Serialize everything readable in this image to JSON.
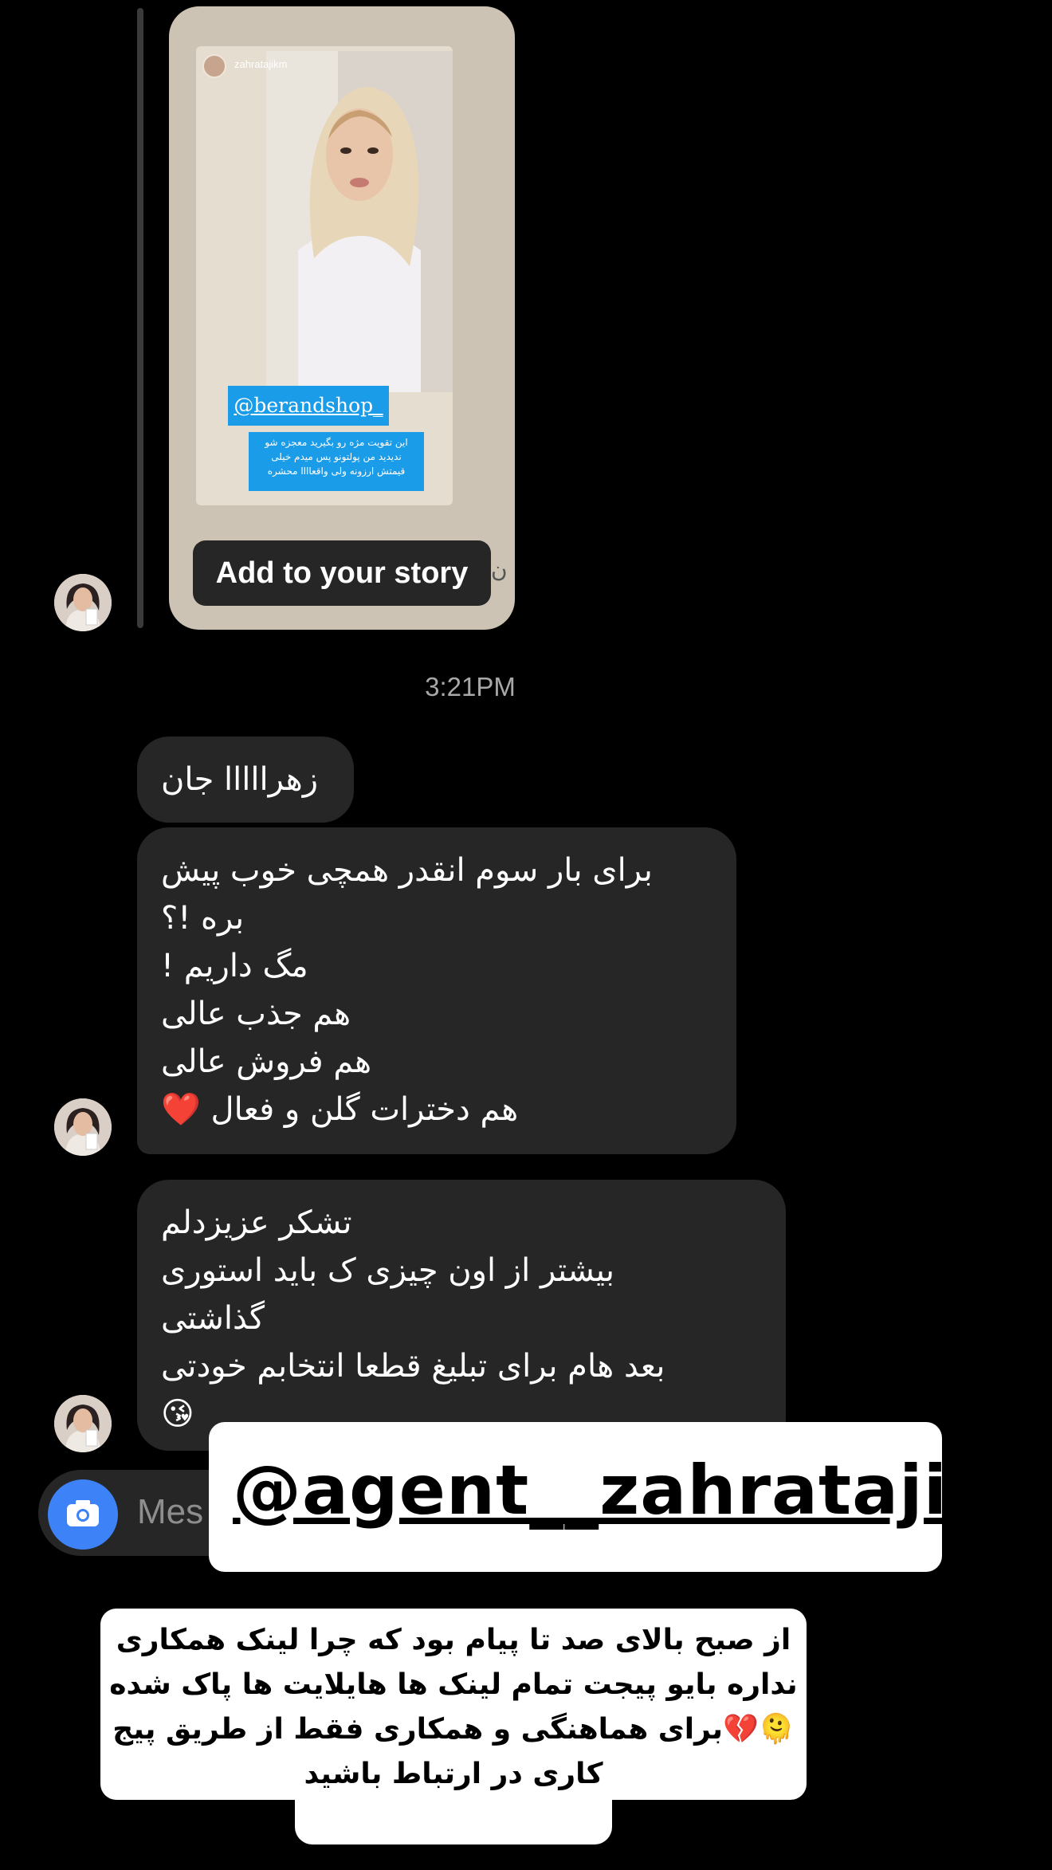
{
  "story": {
    "username": "zahratajikm",
    "mention": "@berandshop_",
    "caption_lines": [
      "این تقویت مژه رو بگیرید معجزه شو",
      "ندیدید من پولتونو پس میدم خیلی",
      "قیمتش ارزونه ولی واقعاااا محشره"
    ],
    "add_button": "Add to your story"
  },
  "timestamp": "3:21PM",
  "messages": [
    {
      "lines": [
        "زهرااااا جان"
      ]
    },
    {
      "lines": [
        "برای بار سوم انقدر همچی خوب پیش",
        "بره !؟",
        "مگ داریم !",
        "هم جذب عالی",
        "هم فروش عالی",
        "هم دخترات گلن و فعال"
      ],
      "emoji": "❤️"
    },
    {
      "lines": [
        "تشکر عزیزدلم",
        "بیشتر از اون چیزی ک باید استوری",
        "گذاشتی",
        "بعد هام برای تبلیغ قطعا انتخابم خودتی"
      ],
      "emoji": "😘"
    }
  ],
  "composer": {
    "placeholder": "Mes"
  },
  "overlay": {
    "agent_handle": "@agent__zahratajiik",
    "notice_lines": [
      "از صبح بالای صد تا پیام بود که چرا لینک همکاری",
      "نداره بایو پیجت تمام لینک ها هایلایت ها پاک شده",
      "🫠💔برای هماهنگی و همکاری فقط از طریق پیج",
      "کاری در ارتباط باشید"
    ]
  },
  "colors": {
    "background": "#000000",
    "bubble": "#262626",
    "camera": "#3d82f6",
    "tag": "#1a9ce8"
  }
}
